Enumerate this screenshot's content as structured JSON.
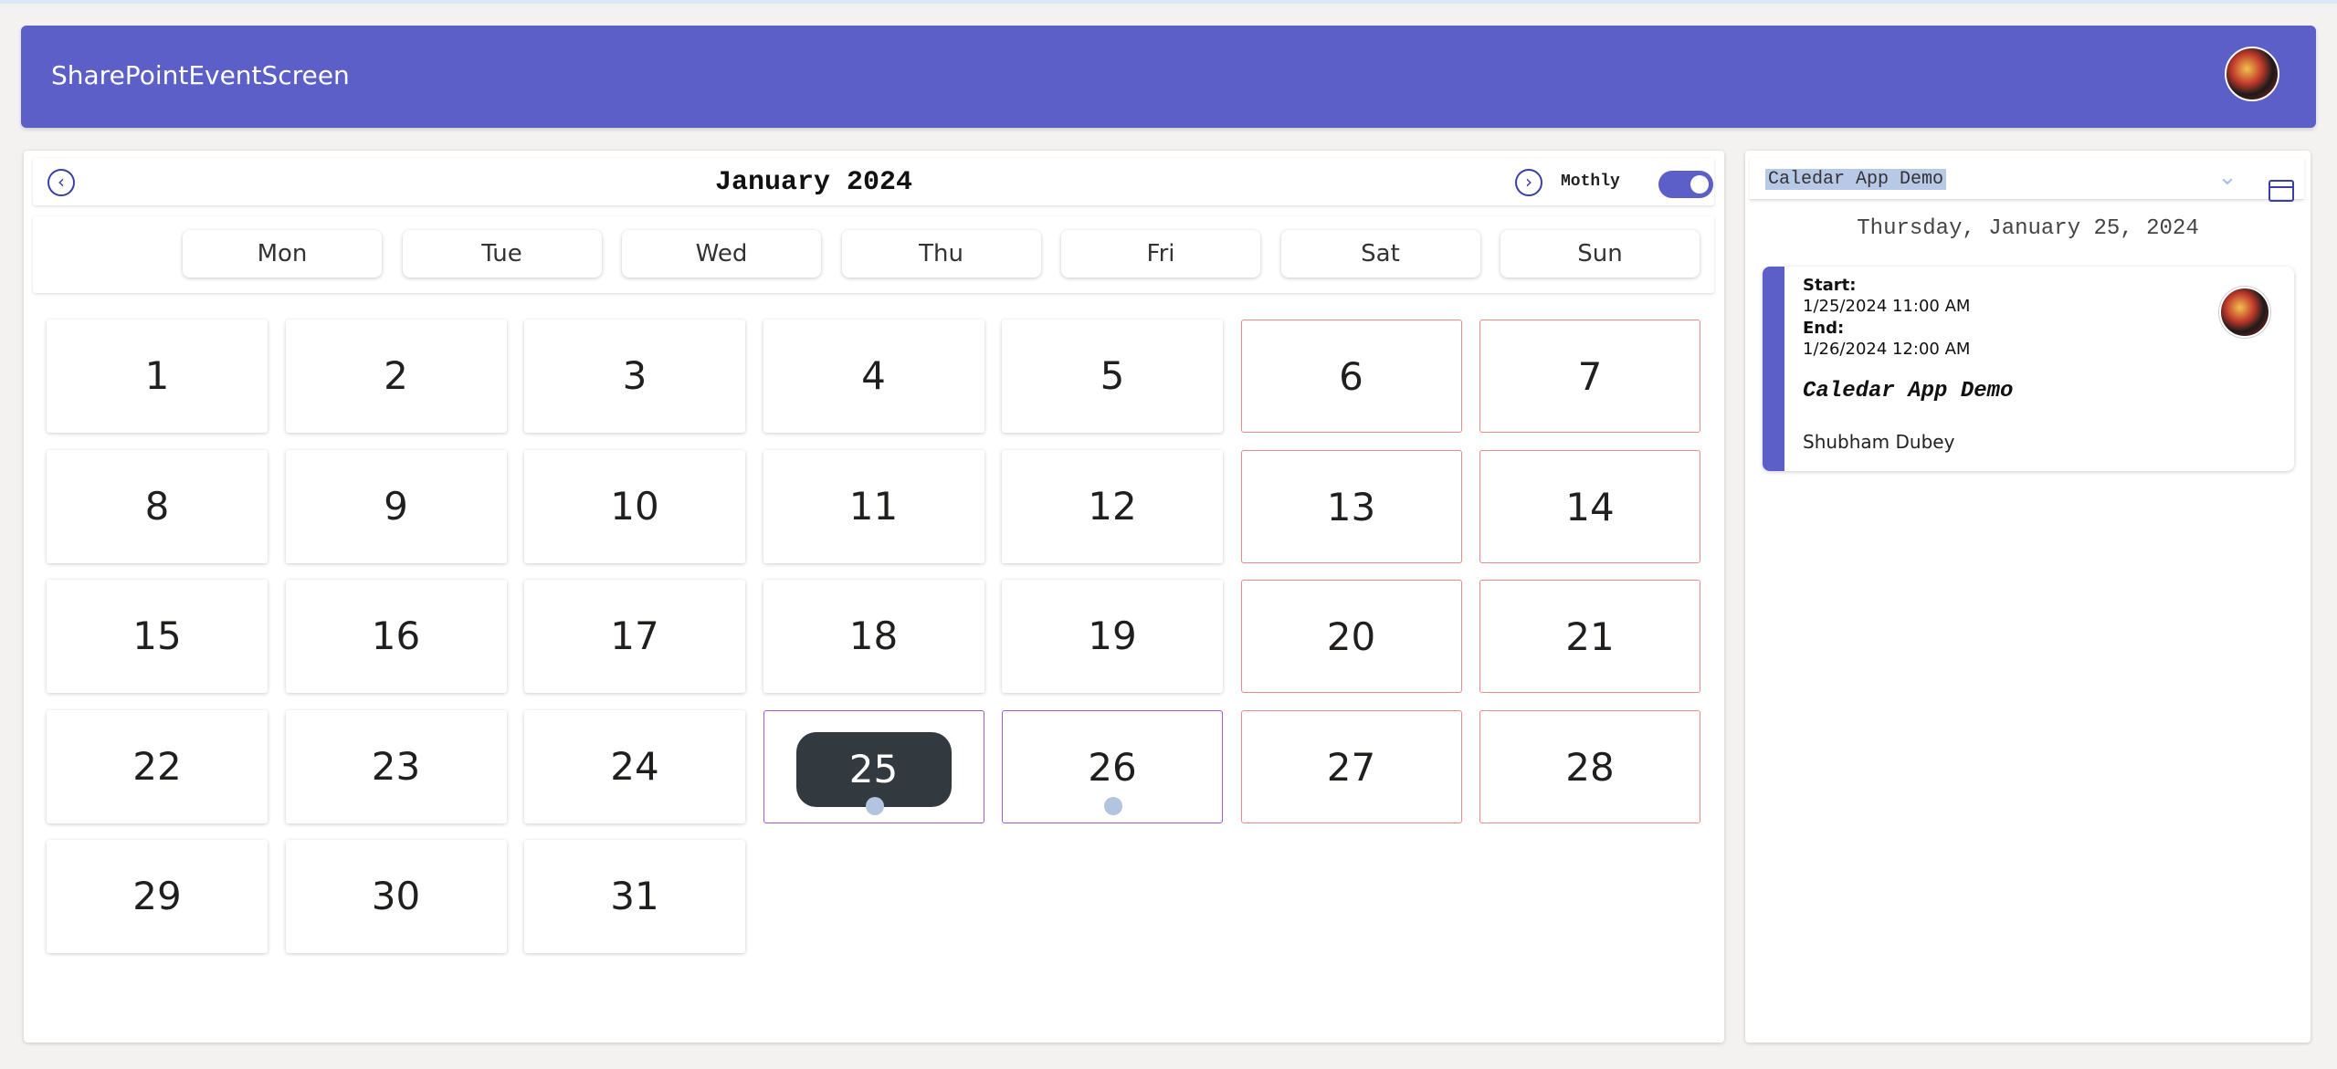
{
  "app": {
    "title": "SharePointEventScreen"
  },
  "colors": {
    "accent": "#5b5fc7",
    "weekend_border": "#f08a8a",
    "event_border": "#a05cd6",
    "selected_bg": "#323a40",
    "event_dot": "#b3c4e0"
  },
  "calendar": {
    "month_label": "January 2024",
    "view_toggle_label": "Mothly",
    "view_toggle_on": true,
    "weekdays": [
      "Mon",
      "Tue",
      "Wed",
      "Thu",
      "Fri",
      "Sat",
      "Sun"
    ],
    "days": [
      "1",
      "2",
      "3",
      "4",
      "5",
      "6",
      "7",
      "8",
      "9",
      "10",
      "11",
      "12",
      "13",
      "14",
      "15",
      "16",
      "17",
      "18",
      "19",
      "20",
      "21",
      "22",
      "23",
      "24",
      "25",
      "26",
      "27",
      "28",
      "29",
      "30",
      "31"
    ],
    "selected_day": "25",
    "event_days": [
      "25",
      "26"
    ],
    "icons": {
      "prev": "chevron-left-circle-icon",
      "next": "chevron-right-circle-icon"
    }
  },
  "side": {
    "search_value": "Caledar App Demo",
    "selected_date_label": "Thursday, January 25, 2024",
    "icons": {
      "dropdown": "chevron-down-icon",
      "calendar": "calendar-icon"
    },
    "event": {
      "start_label": "Start:",
      "start_value": "1/25/2024 11:00 AM",
      "end_label": "End:",
      "end_value": "1/26/2024 12:00 AM",
      "title": "Caledar App Demo",
      "owner": "Shubham Dubey"
    }
  }
}
